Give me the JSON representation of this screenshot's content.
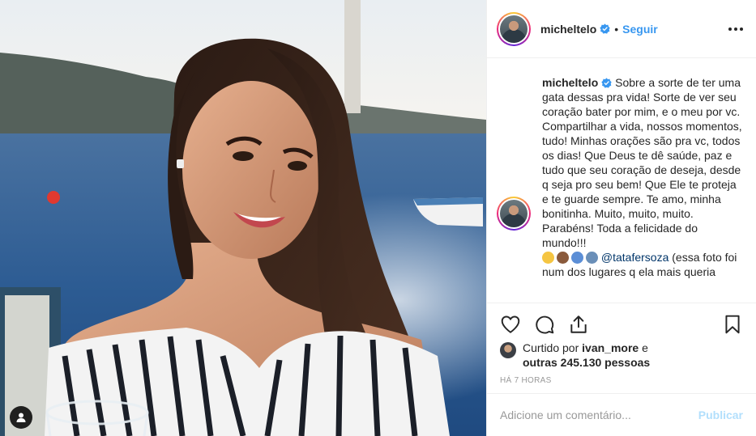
{
  "post": {
    "author": {
      "username": "micheltelo",
      "verified": true,
      "follow_label": "Seguir",
      "separator": "•"
    },
    "caption": {
      "username": "micheltelo",
      "text": " Sobre a sorte de ter uma gata dessas pra vida! Sorte de ver seu coração bater por mim, e o meu por vc. Compartilhar a vida, nossos momentos, tudo! Minhas orações são pra vc, todos os dias! Que Deus te dê saúde, paz e tudo que seu coração de deseja, desde q seja pro seu bem! Que Ele te proteja e te guarde sempre. Te amo, minha bonitinha. Muito, muito, muito. Parabéns! Toda a felicidade do mundo!!!",
      "mention": "@tatafersoza",
      "trailing_text": " (essa foto foi num dos lugares q ela mais queria"
    },
    "likes": {
      "prefix": "Curtido por ",
      "liker": "ivan_more",
      "conjunction": " e",
      "others": "outras 245.130 pessoas"
    },
    "time_ago": "HÁ 7 HORAS",
    "comment_box": {
      "placeholder": "Adicione um comentário...",
      "publish_label": "Publicar"
    }
  },
  "icons": {
    "more": "more-options-icon",
    "like": "heart-icon",
    "comment": "comment-icon",
    "share": "share-icon",
    "save": "bookmark-icon",
    "verified": "verified-badge-icon",
    "tag": "user-tag-icon"
  },
  "colors": {
    "link_blue": "#3897f0",
    "verified_blue": "#3897f0",
    "publish_disabled": "#b2dffc",
    "muted": "#999999",
    "border": "#efefef"
  }
}
